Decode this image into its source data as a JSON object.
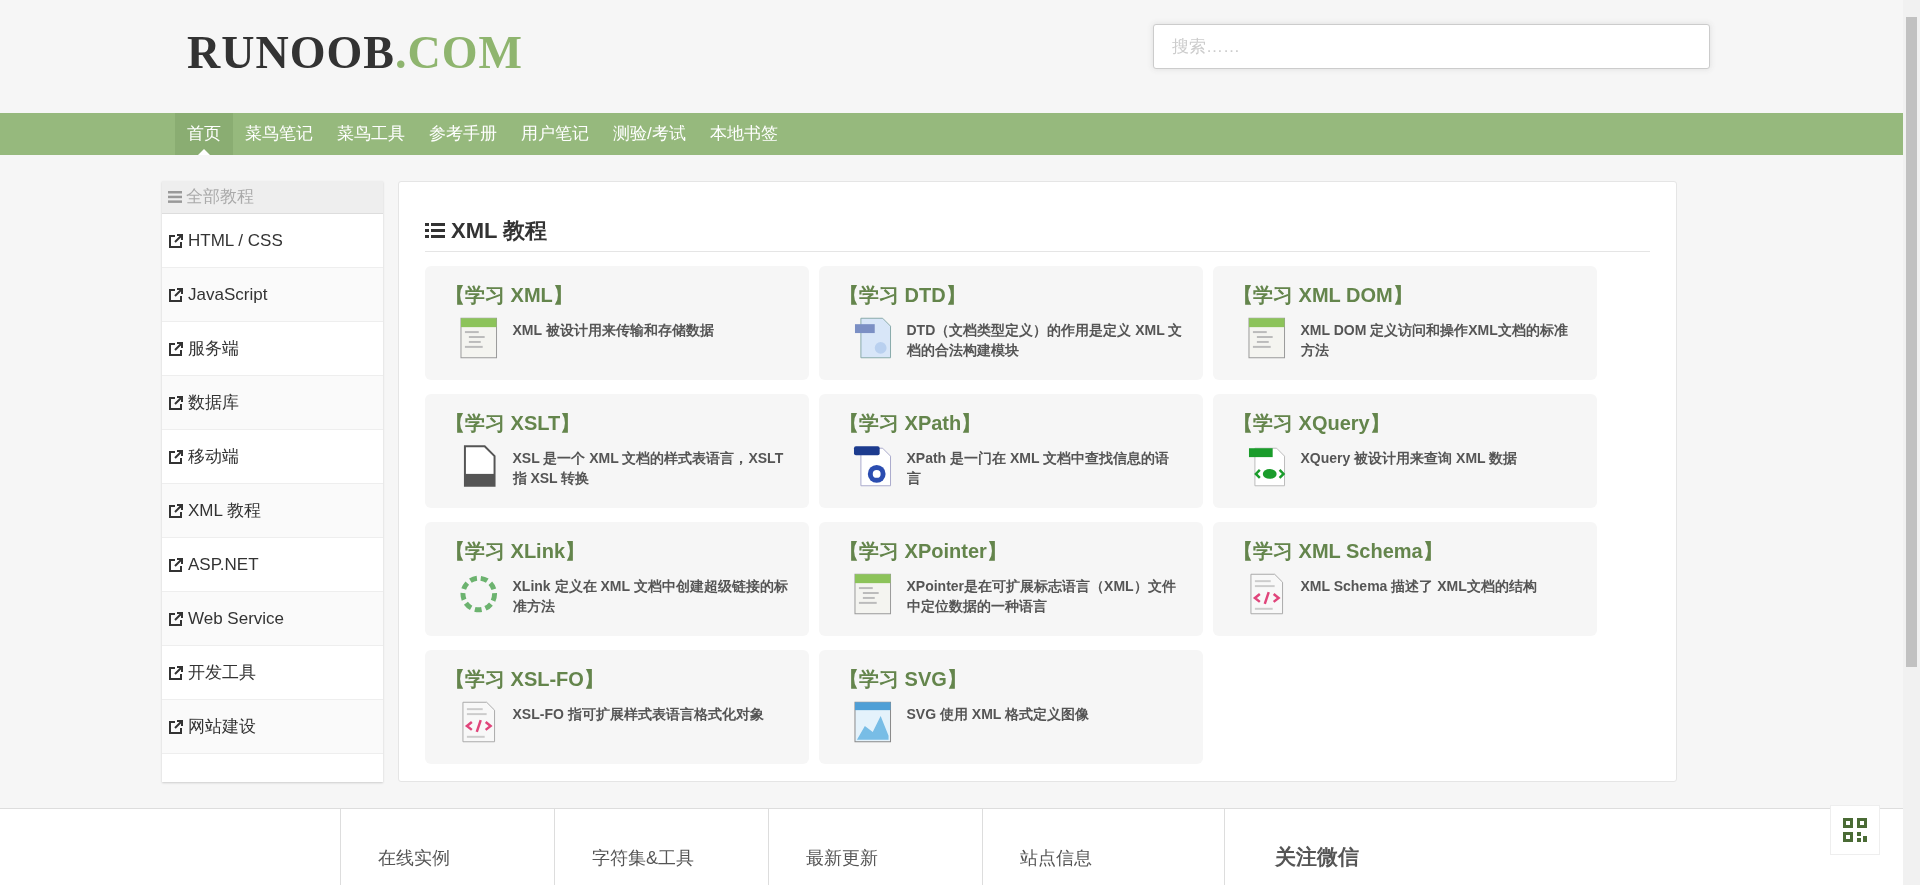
{
  "logo": {
    "main": "RUNOOB",
    "suffix": ".COM"
  },
  "search": {
    "placeholder": "搜索……"
  },
  "nav": [
    {
      "label": "首页",
      "selected": true
    },
    {
      "label": "菜鸟笔记",
      "selected": false
    },
    {
      "label": "菜鸟工具",
      "selected": false
    },
    {
      "label": "参考手册",
      "selected": false
    },
    {
      "label": "用户笔记",
      "selected": false
    },
    {
      "label": "测验/考试",
      "selected": false
    },
    {
      "label": "本地书签",
      "selected": false
    }
  ],
  "sidebar": {
    "title": "全部教程",
    "items": [
      "HTML / CSS",
      "JavaScript",
      "服务端",
      "数据库",
      "移动端",
      "XML 教程",
      "ASP.NET",
      "Web Service",
      "开发工具",
      "网站建设"
    ]
  },
  "main": {
    "title": "XML 教程",
    "cards": [
      {
        "title": "【学习 XML】",
        "description": "XML 被设计用来传输和存储数据"
      },
      {
        "title": "【学习 DTD】",
        "description": "DTD（文档类型定义）的作用是定义 XML 文档的合法构建模块"
      },
      {
        "title": "【学习 XML DOM】",
        "description": "XML DOM 定义访问和操作XML文档的标准方法"
      },
      {
        "title": "【学习 XSLT】",
        "description": "XSL 是一个 XML 文档的样式表语言，XSLT 指 XSL 转换"
      },
      {
        "title": "【学习 XPath】",
        "description": "XPath 是一门在 XML 文档中查找信息的语言"
      },
      {
        "title": "【学习 XQuery】",
        "description": "XQuery 被设计用来查询 XML 数据"
      },
      {
        "title": "【学习 XLink】",
        "description": "XLink 定义在 XML 文档中创建超级链接的标准方法"
      },
      {
        "title": "【学习 XPointer】",
        "description": "XPointer是在可扩展标志语言（XML）文件中定位数据的一种语言"
      },
      {
        "title": "【学习 XML Schema】",
        "description": "XML Schema 描述了 XML文档的结构"
      },
      {
        "title": "【学习 XSL-FO】",
        "description": "XSL-FO 指可扩展样式表语言格式化对象"
      },
      {
        "title": "【学习 SVG】",
        "description": "SVG 使用 XML 格式定义图像"
      }
    ]
  },
  "footer": {
    "columns": [
      "在线实例",
      "字符集&工具",
      "最新更新",
      "站点信息"
    ],
    "wechat": "关注微信"
  }
}
